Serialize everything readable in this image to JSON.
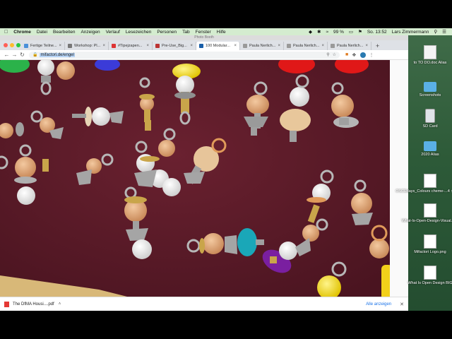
{
  "menubar": {
    "app": "Chrome",
    "items": [
      "Datei",
      "Bearbeiten",
      "Anzeigen",
      "Verlauf",
      "Lesezeichen",
      "Personen",
      "Tab",
      "Fenster",
      "Hilfe"
    ],
    "battery": "99 %",
    "clock": "So. 13:52",
    "user": "Lars Zimmermann"
  },
  "browser": {
    "window_title": "Photo Booth",
    "tabs": [
      {
        "label": "Fertige Teilne...",
        "color": "#4a90d9",
        "active": false
      },
      {
        "label": "Workshop: Pl...",
        "color": "#777777",
        "active": false
      },
      {
        "label": "#Tipejzapen...",
        "color": "#d33",
        "active": false
      },
      {
        "label": "Pre-Use_Big...",
        "color": "#b33",
        "active": false
      },
      {
        "label": "100 Modular...",
        "color": "#1a5fa8",
        "active": true
      },
      {
        "label": "Paula Nerlich...",
        "color": "#999999",
        "active": false
      },
      {
        "label": "Paula Nerlich...",
        "color": "#999999",
        "active": false
      },
      {
        "label": "Paula Nerlich...",
        "color": "#999999",
        "active": false
      }
    ],
    "url": "mifactori.de/engel",
    "downloads": {
      "file": "The DfMA Housi....pdf",
      "show_all": "Alle anzeigen"
    }
  },
  "desktop": {
    "icons": [
      {
        "label": "to TO DO.doc Alias",
        "kind": "doc"
      },
      {
        "label": "Screenshots",
        "kind": "folder"
      },
      {
        "label": "SD Card",
        "kind": "sdcard"
      },
      {
        "label": "2020 Alias",
        "kind": "folder"
      },
      {
        "label": "OSCEdays_Colours cheme-...4 ↑ ↔ ↑↔",
        "kind": "img"
      },
      {
        "label": "What-Is-Open-Design-Visual.png",
        "kind": "img"
      },
      {
        "label": "Mifactori Logo.png",
        "kind": "img"
      },
      {
        "label": "What Is Open Design BIG",
        "kind": "img"
      }
    ]
  },
  "colors": {
    "menubar_bg": "#d4eccf",
    "video_bg": "#5a1a26",
    "desktop_bg": "#2f5a3a",
    "accent": "#1a73e8"
  }
}
